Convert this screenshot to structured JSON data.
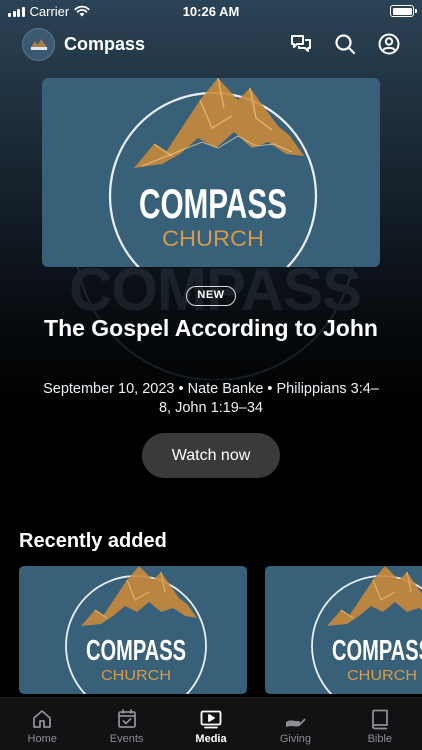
{
  "status_bar": {
    "carrier": "Carrier",
    "time": "10:26 AM"
  },
  "header": {
    "title": "Compass",
    "icons": [
      "chat-icon",
      "search-icon",
      "profile-icon"
    ]
  },
  "hero": {
    "badge": "NEW",
    "title": "The Gospel According to John",
    "meta": "September 10, 2023 • Nate Banke • Philippians 3:4–8, John 1:19–34",
    "button_label": "Watch now",
    "art": {
      "line1": "COMPASS",
      "line2": "CHURCH"
    }
  },
  "recently_added": {
    "title": "Recently added",
    "items": [
      {
        "line1": "COMPASS",
        "line2": "CHURCH"
      },
      {
        "line1": "COMPASS",
        "line2": "CHURCH"
      }
    ]
  },
  "tab_bar": {
    "tabs": [
      {
        "label": "Home",
        "icon": "home-icon",
        "active": false
      },
      {
        "label": "Events",
        "icon": "calendar-icon",
        "active": false
      },
      {
        "label": "Media",
        "icon": "play-icon",
        "active": true
      },
      {
        "label": "Giving",
        "icon": "giving-hand-icon",
        "active": false
      },
      {
        "label": "Bible",
        "icon": "book-icon",
        "active": false
      }
    ]
  },
  "colors": {
    "background": "#000000",
    "art_blue": "#386079",
    "mountain_orange": "#c98a3a",
    "church_text": "#d59b4c"
  }
}
